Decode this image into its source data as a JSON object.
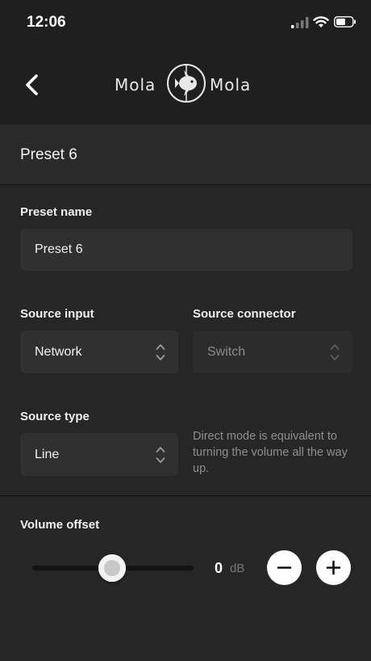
{
  "status_bar": {
    "time": "12:06",
    "icons": [
      "cellular-signal-icon",
      "wifi-icon",
      "battery-icon"
    ]
  },
  "nav": {
    "back_icon": "chevron-left-icon",
    "logo_left": "Mola",
    "logo_right": "Mola"
  },
  "header": {
    "title": "Preset 6"
  },
  "form": {
    "preset_name": {
      "label": "Preset name",
      "value": "Preset 6"
    },
    "source_input": {
      "label": "Source input",
      "value": "Network"
    },
    "source_connector": {
      "label": "Source connector",
      "value": "Switch"
    },
    "source_type": {
      "label": "Source type",
      "value": "Line",
      "hint": "Direct mode is equivalent to turning the volume all the way up."
    },
    "volume_offset": {
      "label": "Volume offset",
      "value": "0",
      "unit": "dB"
    }
  },
  "colors": {
    "background": "#262626",
    "bar": "#1f1f1f",
    "field": "#303030",
    "text": "#f2f2f2",
    "muted": "#8f8f8f"
  }
}
